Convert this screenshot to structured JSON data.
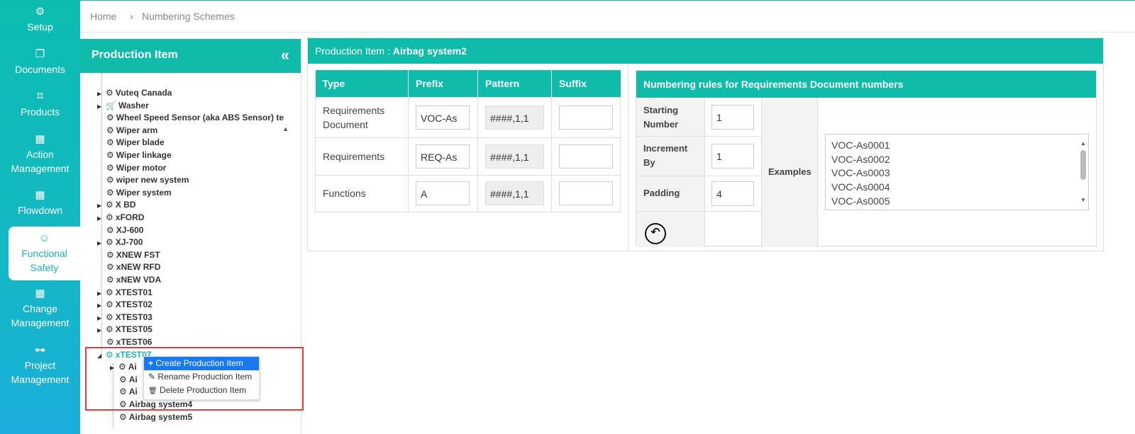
{
  "nav": [
    {
      "icon": "⚙",
      "label": "Setup"
    },
    {
      "icon": "❐",
      "label": "Documents"
    },
    {
      "icon": "⌑",
      "label": "Products"
    },
    {
      "icon": "▦",
      "label": "Action Management"
    },
    {
      "icon": "▦",
      "label": "Flowdown"
    },
    {
      "icon": "☺",
      "label": "Functional Safety"
    },
    {
      "icon": "▦",
      "label": "Change Management"
    },
    {
      "icon": "⊶",
      "label": "Project Management"
    }
  ],
  "breadcrumb": {
    "home": "Home",
    "sep": "›",
    "current": "Numbering Schemes"
  },
  "left_panel": {
    "title": "Production Item",
    "collapse_icon": "«"
  },
  "tree": [
    {
      "label": "Vuteq Canada"
    },
    {
      "label": "Washer"
    },
    {
      "label": "Wheel Speed Sensor (aka ABS Sensor) te"
    },
    {
      "label": "Wiper arm"
    },
    {
      "label": "Wiper blade"
    },
    {
      "label": "Wiper linkage"
    },
    {
      "label": "Wiper motor"
    },
    {
      "label": "wiper new system"
    },
    {
      "label": "Wiper system"
    },
    {
      "label": "X BD"
    },
    {
      "label": "xFORD"
    },
    {
      "label": "XJ-600"
    },
    {
      "label": "XJ-700"
    },
    {
      "label": "XNEW FST"
    },
    {
      "label": "xNEW RFD"
    },
    {
      "label": "xNEW VDA"
    },
    {
      "label": "XTEST01"
    },
    {
      "label": "XTEST02"
    },
    {
      "label": "XTEST03"
    },
    {
      "label": "XTEST05"
    },
    {
      "label": "xTEST06"
    },
    {
      "label": "xTEST07"
    },
    {
      "label": "Ai"
    },
    {
      "label": "Ai"
    },
    {
      "label": "Ai"
    },
    {
      "label": "Airbag system4"
    },
    {
      "label": "Airbag system5"
    }
  ],
  "context_menu": [
    {
      "icon": "+",
      "label": "Create Production Item"
    },
    {
      "icon": "✎",
      "label": "Rename Production Item"
    },
    {
      "icon": "🗑",
      "label": "Delete Production Item"
    }
  ],
  "main": {
    "header_prefix": "Production Item : ",
    "header_item": "Airbag system2",
    "table": {
      "headers": [
        "Type",
        "Prefix",
        "Pattern",
        "Suffix"
      ],
      "rows": [
        {
          "type": "Requirements Document",
          "prefix": "VOC-As",
          "pattern": "####,1,1",
          "suffix": ""
        },
        {
          "type": "Requirements",
          "prefix": "REQ-As",
          "pattern": "####,1,1",
          "suffix": ""
        },
        {
          "type": "Functions",
          "prefix": "A",
          "pattern": "####,1,1",
          "suffix": ""
        }
      ]
    },
    "rules": {
      "title_prefix": "Numbering rules for ",
      "title_bold": "Requirements Document numbers",
      "starting_label": "Starting Number",
      "starting_value": "1",
      "increment_label": "Increment By",
      "increment_value": "1",
      "padding_label": "Padding",
      "padding_value": "4",
      "examples_label": "Examples",
      "examples": [
        "VOC-As0001",
        "VOC-As0002",
        "VOC-As0003",
        "VOC-As0004",
        "VOC-As0005"
      ],
      "reset_icon": "↶"
    }
  }
}
